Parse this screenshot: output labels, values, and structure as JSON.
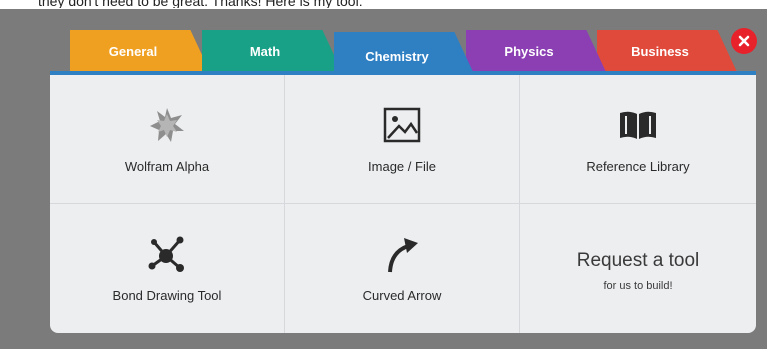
{
  "page_caption": "they don't need to be great. Thanks! Here is my tool:",
  "tabs": [
    {
      "label": "General",
      "color": "#f0a020"
    },
    {
      "label": "Math",
      "color": "#19a187"
    },
    {
      "label": "Chemistry",
      "color": "#2f7fc3",
      "active": true
    },
    {
      "label": "Physics",
      "color": "#8b3fb3"
    },
    {
      "label": "Business",
      "color": "#e04a3b"
    }
  ],
  "close_icon": "close-icon",
  "tools": [
    {
      "label": "Wolfram Alpha",
      "icon": "wolfram-alpha-icon"
    },
    {
      "label": "Image / File",
      "icon": "image-icon"
    },
    {
      "label": "Reference Library",
      "icon": "book-icon"
    },
    {
      "label": "Bond Drawing Tool",
      "icon": "molecule-icon"
    },
    {
      "label": "Curved Arrow",
      "icon": "curved-arrow-icon"
    }
  ],
  "request": {
    "title": "Request a tool",
    "subtitle": "for us to build!"
  }
}
